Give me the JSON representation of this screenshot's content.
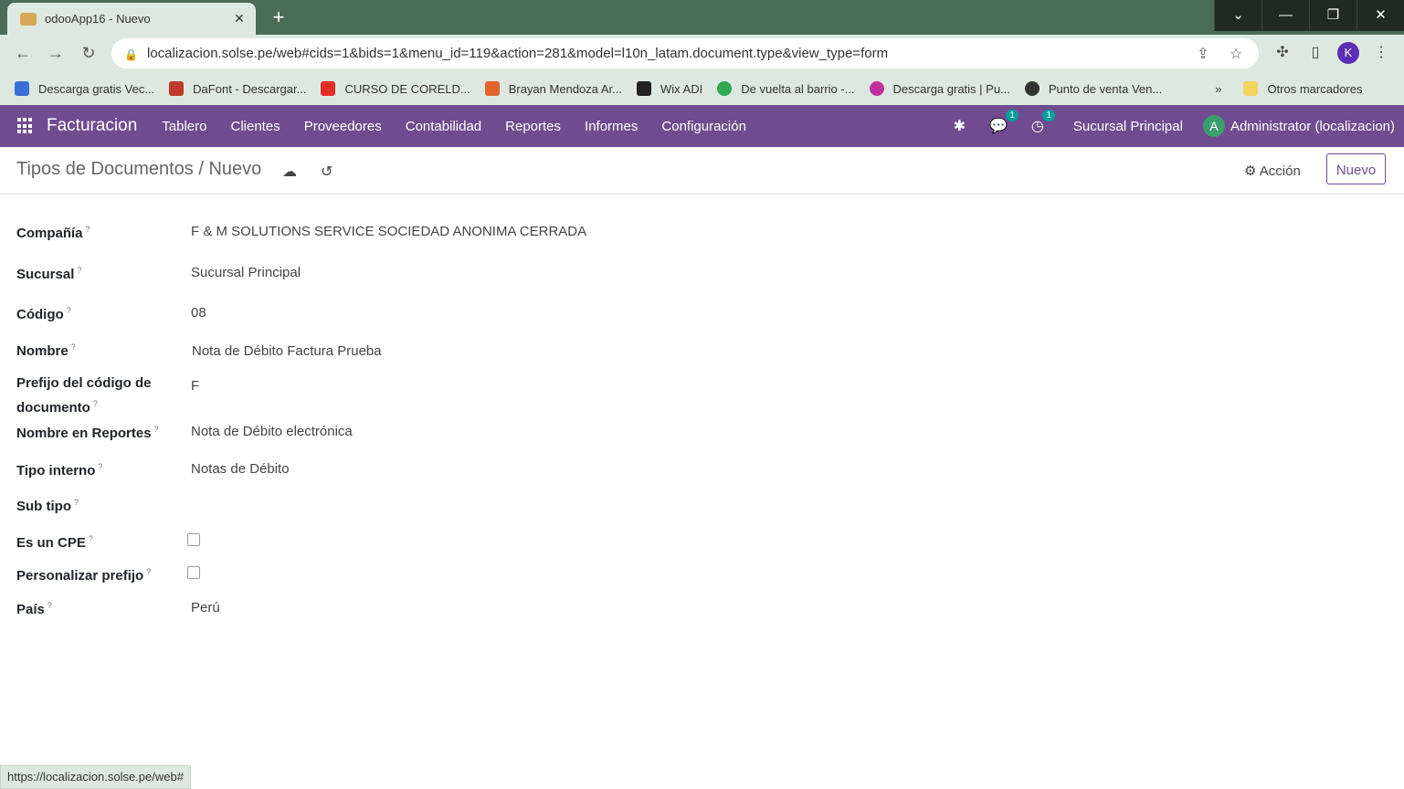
{
  "browser": {
    "tab_title": "odooApp16 - Nuevo",
    "tab_close": "✕",
    "new_tab": "+",
    "url": "localizacion.solse.pe/web#cids=1&bids=1&menu_id=119&action=281&model=l10n_latam.document.type&view_type=form",
    "profile_initial": "K",
    "status_url": "https://localizacion.solse.pe/web#",
    "bookmarks": [
      {
        "label": "Descarga gratis Vec...",
        "color": "#3b6fd8"
      },
      {
        "label": "DaFont - Descargar...",
        "color": "#c0392b"
      },
      {
        "label": "CURSO DE CORELD...",
        "color": "#e52d27"
      },
      {
        "label": "Brayan Mendoza Ar...",
        "color": "#e2632a"
      },
      {
        "label": "Wix ADI",
        "color": "#222222"
      },
      {
        "label": "De vuelta al barrio -...",
        "color": "#2fa84f"
      },
      {
        "label": "Descarga gratis | Pu...",
        "color": "#c0309a"
      },
      {
        "label": "Punto de venta Ven...",
        "color": "#333333"
      }
    ],
    "bookmarks_more": "»",
    "other_bookmarks": "Otros marcadores"
  },
  "nav": {
    "app_name": "Facturacion",
    "menu": [
      "Tablero",
      "Clientes",
      "Proveedores",
      "Contabilidad",
      "Reportes",
      "Informes",
      "Configuración"
    ],
    "messages_badge": "1",
    "activities_badge": "1",
    "company": "Sucursal Principal",
    "user_initial": "A",
    "user_name": "Administrator (localizacion)"
  },
  "control_panel": {
    "breadcrumb": "Tipos de Documentos / Nuevo",
    "action_label": "Acción",
    "new_button": "Nuevo"
  },
  "form": {
    "fields": [
      {
        "label": "Compañía",
        "value": "F & M SOLUTIONS SERVICE SOCIEDAD ANONIMA CERRADA"
      },
      {
        "label": "Sucursal",
        "value": "Sucursal Principal"
      },
      {
        "label": "Código",
        "value": "08"
      },
      {
        "label": "Nombre",
        "value": "Nota de Débito Factura Prueba"
      },
      {
        "label": "Prefijo del código de documento",
        "value": "F"
      },
      {
        "label": "Nombre en Reportes",
        "value": "Nota de Débito electrónica"
      },
      {
        "label": "Tipo interno",
        "value": "Notas de Débito"
      },
      {
        "label": "Sub tipo",
        "value": ""
      },
      {
        "label": "Es un CPE",
        "value": false
      },
      {
        "label": "Personalizar prefijo",
        "value": false
      },
      {
        "label": "País",
        "value": "Perú"
      }
    ],
    "help_marker": "?"
  }
}
